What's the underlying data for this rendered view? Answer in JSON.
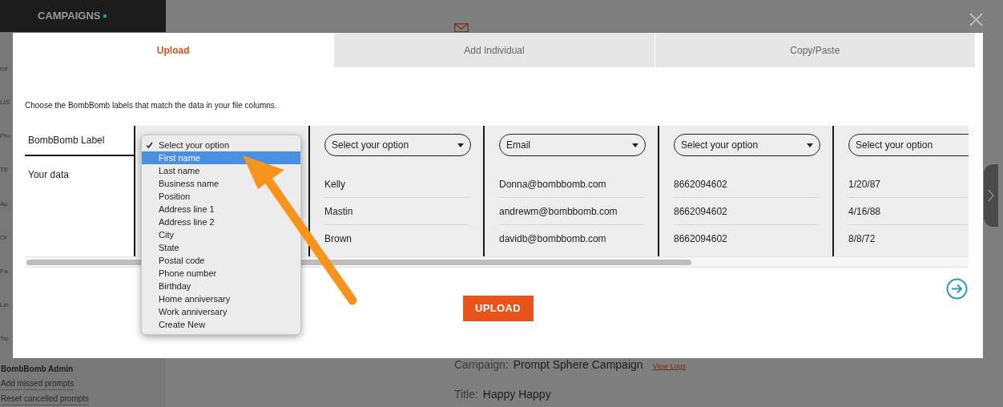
{
  "background": {
    "sidebar_title": "CAMPAIGNS",
    "sidebar_fragments": [
      "ror",
      "LIS",
      "Pro",
      "TE",
      "Ap",
      "Or",
      "Fa",
      "Lin",
      "Tw"
    ],
    "admin": {
      "title": "BombBomb Admin",
      "links": [
        "Add missed prompts",
        "Reset cancelled prompts"
      ]
    },
    "details": [
      {
        "label": "Campaign:",
        "value": "Prompt Sphere Campaign",
        "link": "View Logs"
      },
      {
        "label": "Title:",
        "value": "Happy Happy"
      }
    ]
  },
  "modal": {
    "tabs": [
      {
        "label": "Upload",
        "selected": true
      },
      {
        "label": "Add Individual",
        "selected": false
      },
      {
        "label": "Copy/Paste",
        "selected": false
      }
    ],
    "instruction": "Choose the BombBomb labels that match the data in your file columns.",
    "row_labels": [
      "BombBomb Label",
      "Your data"
    ],
    "columns": [
      {},
      {
        "select": "Select your option",
        "cells": [
          "Kelly",
          "Mastin",
          "Brown"
        ]
      },
      {
        "select": "Email",
        "cells": [
          "Donna@bombbomb.com",
          "andrewm@bombbomb.com",
          "davidb@bombbomb.com"
        ]
      },
      {
        "select": "Select your option",
        "cells": [
          "8662094602",
          "8662094602",
          "8662094602"
        ]
      },
      {
        "select": "Select your option",
        "cells": [
          "1/20/87",
          "4/16/88",
          "8/8/72"
        ]
      }
    ],
    "dropdown": [
      {
        "label": "Select your option",
        "checked": true,
        "selected": false
      },
      {
        "label": "First name",
        "checked": false,
        "selected": true
      },
      {
        "label": "Last name",
        "checked": false,
        "selected": false
      },
      {
        "label": "Business name",
        "checked": false,
        "selected": false
      },
      {
        "label": "Position",
        "checked": false,
        "selected": false
      },
      {
        "label": "Address line 1",
        "checked": false,
        "selected": false
      },
      {
        "label": "Address line 2",
        "checked": false,
        "selected": false
      },
      {
        "label": "City",
        "checked": false,
        "selected": false
      },
      {
        "label": "State",
        "checked": false,
        "selected": false
      },
      {
        "label": "Postal code",
        "checked": false,
        "selected": false
      },
      {
        "label": "Phone number",
        "checked": false,
        "selected": false
      },
      {
        "label": "Birthday",
        "checked": false,
        "selected": false
      },
      {
        "label": "Home anniversary",
        "checked": false,
        "selected": false
      },
      {
        "label": "Work anniversary",
        "checked": false,
        "selected": false
      },
      {
        "label": "Create New",
        "checked": false,
        "selected": false
      }
    ],
    "upload_button": "UPLOAD"
  }
}
